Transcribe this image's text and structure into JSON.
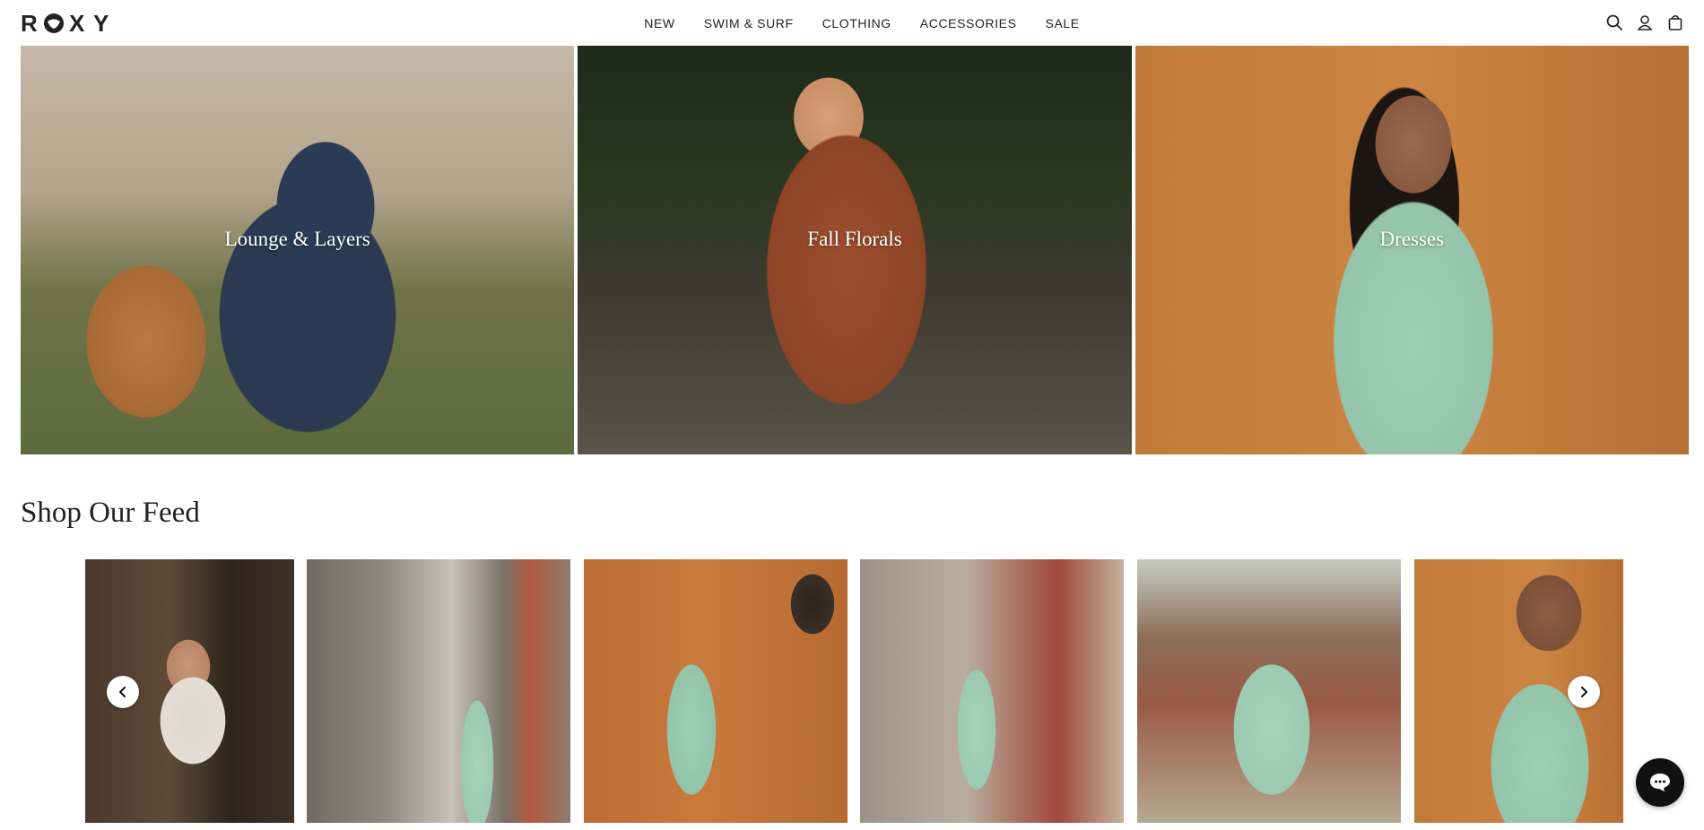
{
  "brand": {
    "logo_text": "ROXY"
  },
  "nav": {
    "items": [
      {
        "label": "NEW"
      },
      {
        "label": "SWIM & SURF"
      },
      {
        "label": "CLOTHING"
      },
      {
        "label": "ACCESSORIES"
      },
      {
        "label": "SALE"
      }
    ]
  },
  "header_icons": [
    "search-icon",
    "account-icon",
    "bag-icon"
  ],
  "categories": [
    {
      "label": "Lounge & Layers"
    },
    {
      "label": "Fall Florals"
    },
    {
      "label": "Dresses"
    }
  ],
  "feed": {
    "title": "Shop Our Feed",
    "item_count": 6
  },
  "colors": {
    "accent": "#111111",
    "background": "#ffffff",
    "text": "#222222"
  }
}
